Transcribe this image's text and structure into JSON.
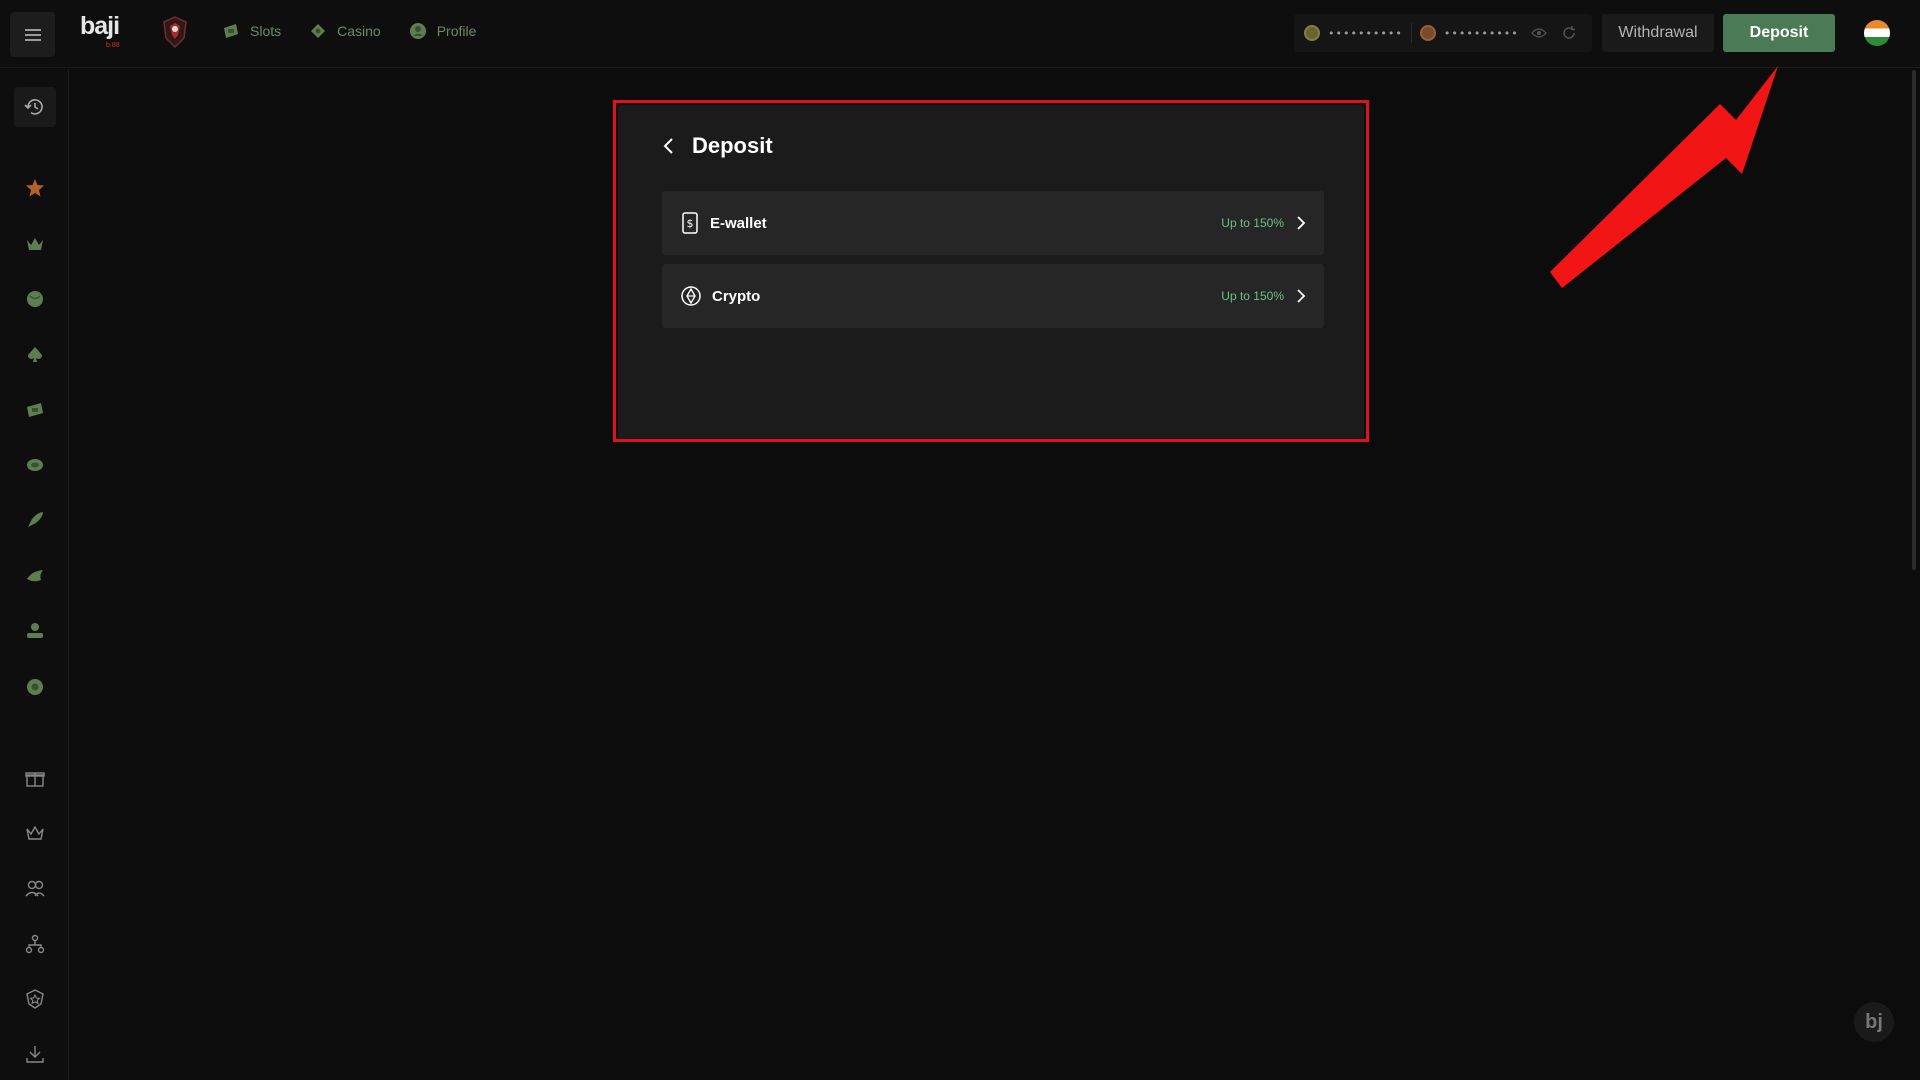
{
  "header": {
    "logo_text": "baji",
    "logo_subtext": "b.88",
    "nav": [
      {
        "label": "Slots",
        "icon": "slots-icon"
      },
      {
        "label": "Casino",
        "icon": "casino-icon"
      },
      {
        "label": "Profile",
        "icon": "profile-icon"
      }
    ],
    "balance_main": "••••••••••",
    "balance_bonus": "••••••••••",
    "withdraw_label": "Withdrawal",
    "deposit_label": "Deposit"
  },
  "sidebar": {
    "icons": [
      "history-icon",
      "star-icon",
      "crown-icon",
      "ball-icon",
      "spade-icon",
      "slots-icon",
      "fish-icon",
      "rocket-icon",
      "bird-icon",
      "cards-icon",
      "lottery-icon",
      "gift-icon",
      "vip-crown-icon",
      "referral-icon",
      "affiliate-icon",
      "badge-icon",
      "download-icon"
    ]
  },
  "deposit_panel": {
    "title": "Deposit",
    "options": [
      {
        "label": "E-wallet",
        "bonus": "Up to 150%",
        "icon": "ewallet-icon"
      },
      {
        "label": "Crypto",
        "bonus": "Up to 150%",
        "icon": "crypto-icon"
      }
    ]
  },
  "floating_badge": "bj",
  "colors": {
    "accent_green": "#4b7a57",
    "bonus_green": "#6fbf83",
    "highlight_red": "#e0101c",
    "background": "#0c0c0c"
  }
}
